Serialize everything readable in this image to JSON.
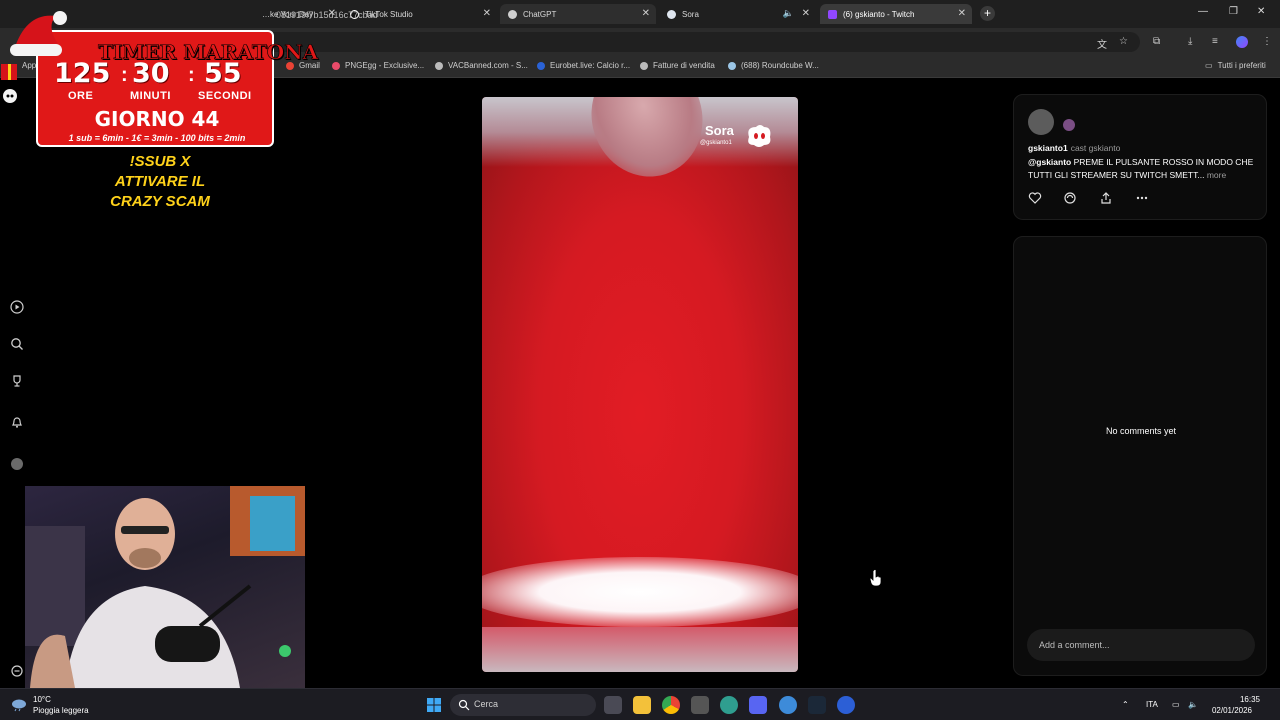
{
  "browser": {
    "tabs": [
      {
        "label": "…ke Your Day",
        "active": false
      },
      {
        "label": "TikTok Studio",
        "active": false
      },
      {
        "label": "ChatGPT",
        "active": false
      },
      {
        "label": "Sora",
        "active": false
      },
      {
        "label": "(6) gskianto - Twitch",
        "active": true
      }
    ],
    "url": "081919f7b15d16c77cbad",
    "bookmarks": [
      {
        "label": "App"
      },
      {
        "label": "Gmail"
      },
      {
        "label": "PNGEgg - Exclusive..."
      },
      {
        "label": "VACBanned.com - S..."
      },
      {
        "label": "Eurobet.live: Calcio r..."
      },
      {
        "label": "Fatture di vendita"
      },
      {
        "label": "(688) Roundcube W..."
      },
      {
        "label": "Tutti i preferiti"
      }
    ]
  },
  "overlay": {
    "header": "TIMER  MARATONA",
    "hours": "125",
    "minutes": "30",
    "seconds": "55",
    "hours_label": "ORE",
    "minutes_label": "MINUTI",
    "seconds_label": "SECONDI",
    "day": "GIORNO 44",
    "rates": "1 sub = 6min - 1€ = 3min - 100 bits = 2min",
    "sub_line1": "!SSUB X",
    "sub_line2": "ATTIVARE IL",
    "sub_line3": "CRAZY SCAM",
    "accent_color": "#e01818",
    "text_color": "#ffd21a"
  },
  "video": {
    "watermark": "Sora",
    "handle": "@gskianto1"
  },
  "post": {
    "author": "gskianto1",
    "cast_text": "cast gskianto",
    "mention": "@gskianto",
    "body": " PREME IL PULSANTE ROSSO IN MODO CHE TUTTI GLI STREAMER SU TWITCH SMETT...",
    "more": "more",
    "actions": [
      "heart-icon",
      "remix-icon",
      "share-icon",
      "more-icon"
    ]
  },
  "comments": {
    "empty_text": "No comments yet",
    "input_placeholder": "Add a comment..."
  },
  "taskbar": {
    "temperature": "10°C",
    "weather": "Pioggia leggera",
    "search_label": "Cerca",
    "language": "ITA",
    "time": "16:35",
    "date": "02/01/2026"
  }
}
